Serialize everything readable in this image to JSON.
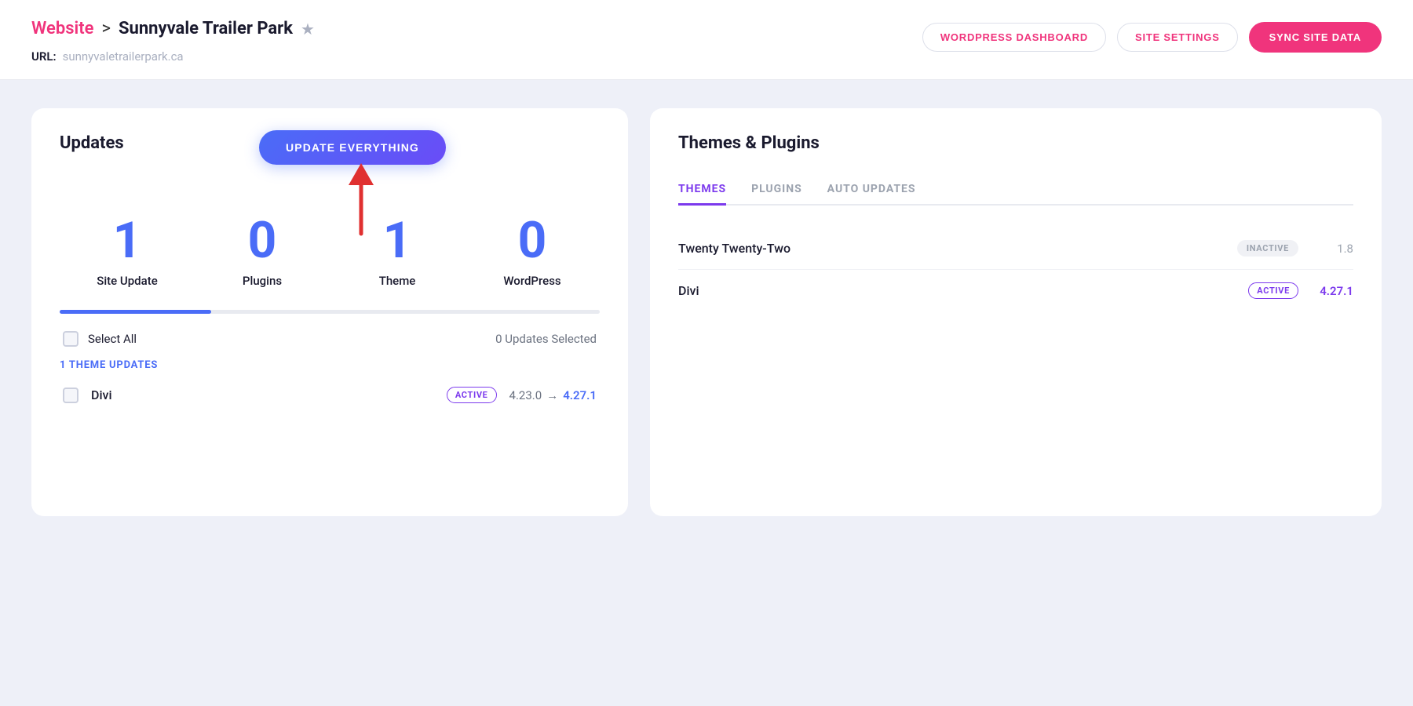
{
  "header": {
    "breadcrumb_link": "Website",
    "breadcrumb_sep": ">",
    "breadcrumb_site": "Sunnyvale Trailer Park",
    "star": "★",
    "url_label": "URL:",
    "url_value": "sunnyvaletrailerpark.ca",
    "btn_wordpress": "WORDPRESS DASHBOARD",
    "btn_settings": "SITE SETTINGS",
    "btn_sync": "SYNC SITE DATA"
  },
  "updates_panel": {
    "title": "Updates",
    "btn_update": "UPDATE EVERYTHING",
    "stats": [
      {
        "number": "1",
        "label": "Site Update"
      },
      {
        "number": "0",
        "label": "Plugins"
      },
      {
        "number": "1",
        "label": "Theme"
      },
      {
        "number": "0",
        "label": "WordPress"
      }
    ],
    "select_all_label": "Select All",
    "updates_selected": "0 Updates Selected",
    "section_label": "1 THEME UPDATES",
    "items": [
      {
        "name": "Divi",
        "badge": "ACTIVE",
        "version_from": "4.23.0",
        "version_to": "4.27.1"
      }
    ]
  },
  "themes_panel": {
    "title": "Themes & Plugins",
    "tabs": [
      {
        "label": "THEMES",
        "active": true
      },
      {
        "label": "PLUGINS",
        "active": false
      },
      {
        "label": "AUTO UPDATES",
        "active": false
      }
    ],
    "themes": [
      {
        "name": "Twenty Twenty-Two",
        "status": "INACTIVE",
        "status_type": "inactive",
        "version": "1.8"
      },
      {
        "name": "Divi",
        "status": "ACTIVE",
        "status_type": "active",
        "version": "4.27.1"
      }
    ]
  }
}
